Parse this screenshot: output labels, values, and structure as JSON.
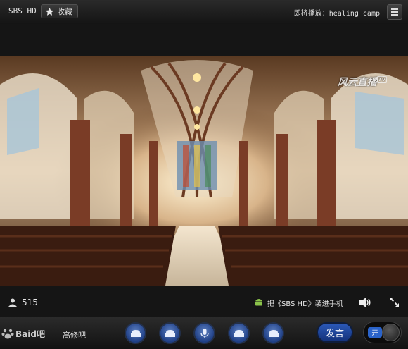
{
  "topbar": {
    "channel": "SBS HD",
    "favorite_label": "收藏",
    "upnext_prefix": "即将播放：",
    "upnext_name": "healing camp"
  },
  "video": {
    "watermark": "风云直播",
    "watermark_badge": "TV"
  },
  "infobar": {
    "viewers": "515",
    "promo": "把《SBS HD》装进手机"
  },
  "bottombar": {
    "logo_text": "Baid吧",
    "forum_label": "高修吧",
    "send_label": "发言",
    "toggle_label": "开"
  },
  "colors": {
    "accent_blue": "#2a63c9",
    "bar_dark": "#151515"
  }
}
